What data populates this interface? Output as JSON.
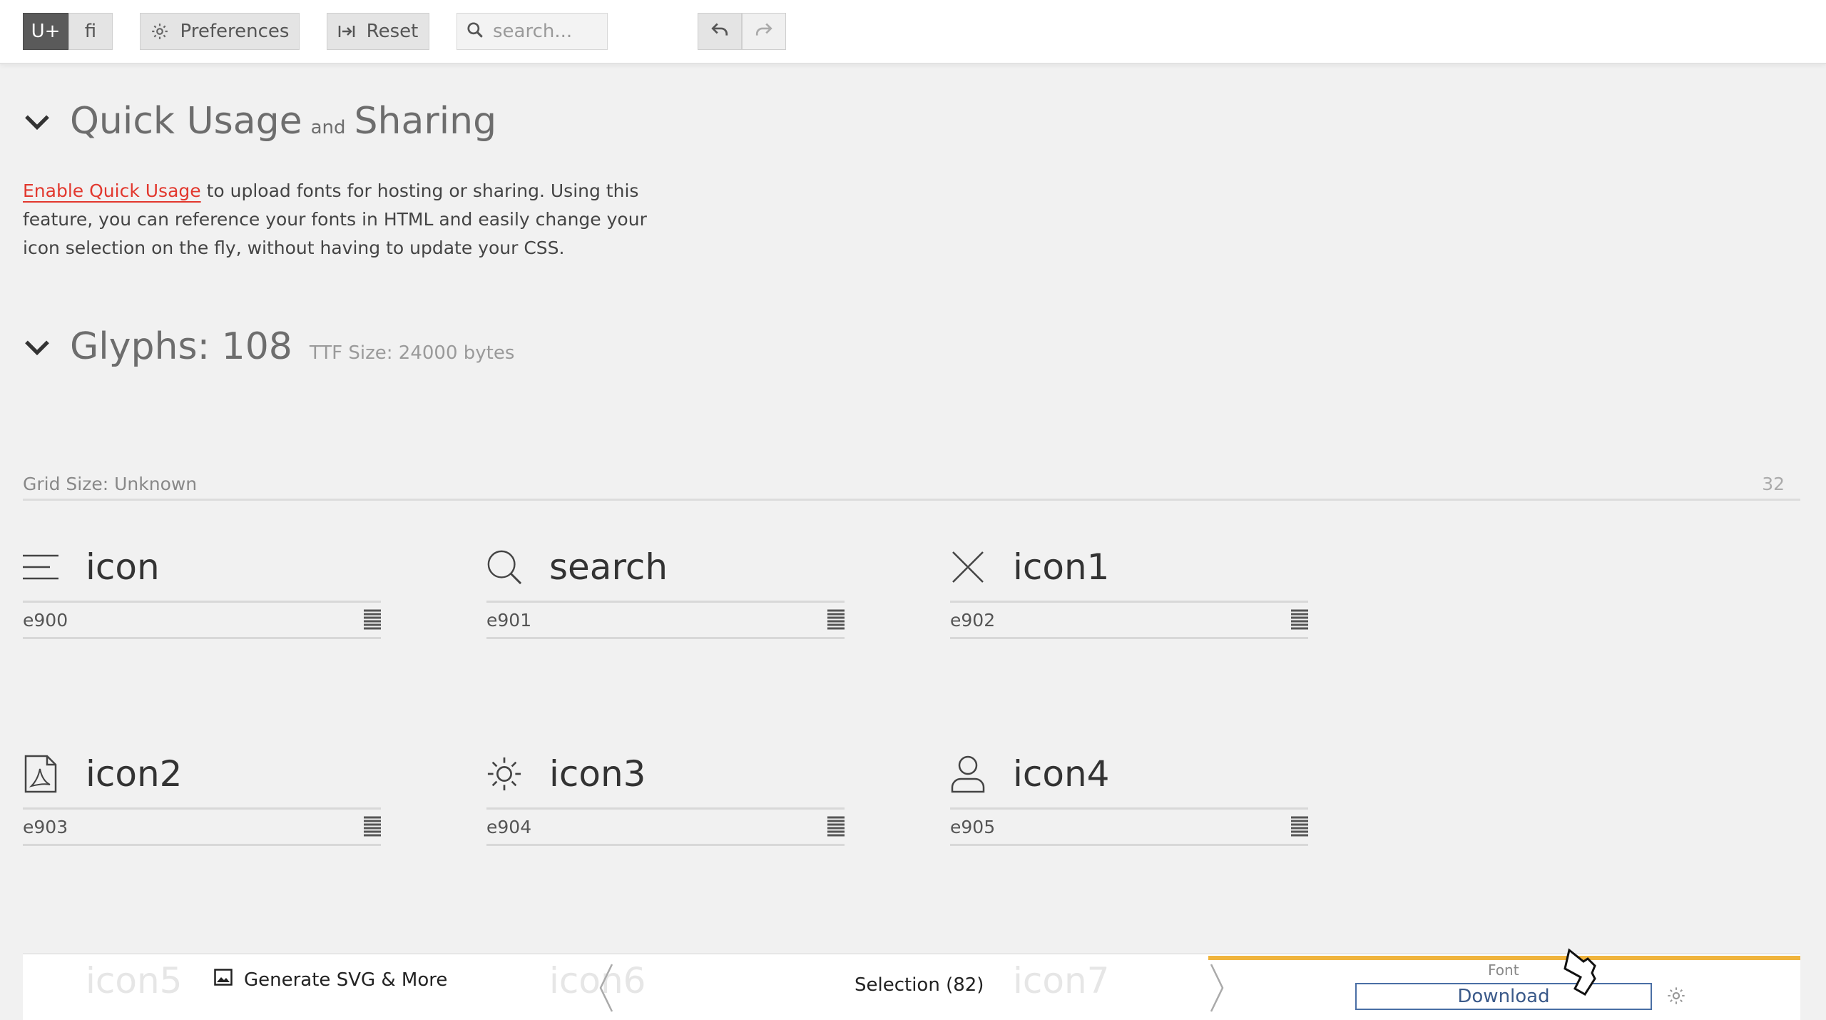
{
  "toolbar": {
    "unicode_label": "U+",
    "ligature_label": "ﬁ",
    "preferences_label": "Preferences",
    "reset_label": "Reset",
    "search_placeholder": "search..."
  },
  "quick_usage": {
    "title_a": "Quick Usage",
    "title_and": "and",
    "title_b": "Sharing",
    "link_text": "Enable Quick Usage",
    "desc_rest": " to upload fonts for hosting or sharing. Using this feature, you can reference your fonts in HTML and easily change your icon selection on the fly, without having to update your CSS."
  },
  "glyphs": {
    "title": "Glyphs: 108",
    "ttf_size": "TTF Size: 24000 bytes",
    "grid_size": "Grid Size: Unknown",
    "grid_num": "32",
    "items": [
      {
        "name": "icon",
        "code": "e900",
        "icon": "menu-icon"
      },
      {
        "name": "search",
        "code": "e901",
        "icon": "search-icon"
      },
      {
        "name": "icon1",
        "code": "e902",
        "icon": "close-icon"
      },
      {
        "name": "icon2",
        "code": "e903",
        "icon": "pdf-file-icon"
      },
      {
        "name": "icon3",
        "code": "e904",
        "icon": "sun-icon"
      },
      {
        "name": "icon4",
        "code": "e905",
        "icon": "user-icon"
      }
    ],
    "ghost_items": [
      "icon5",
      "icon6",
      "icon7"
    ]
  },
  "bottombar": {
    "generate_label": "Generate SVG & More",
    "selection_label": "Selection (82)",
    "font_label": "Font",
    "download_label": "Download"
  },
  "colors": {
    "accent_link": "#e2382e",
    "font_panel_accent": "#f0b43c",
    "download_border": "#4a6fa5"
  }
}
